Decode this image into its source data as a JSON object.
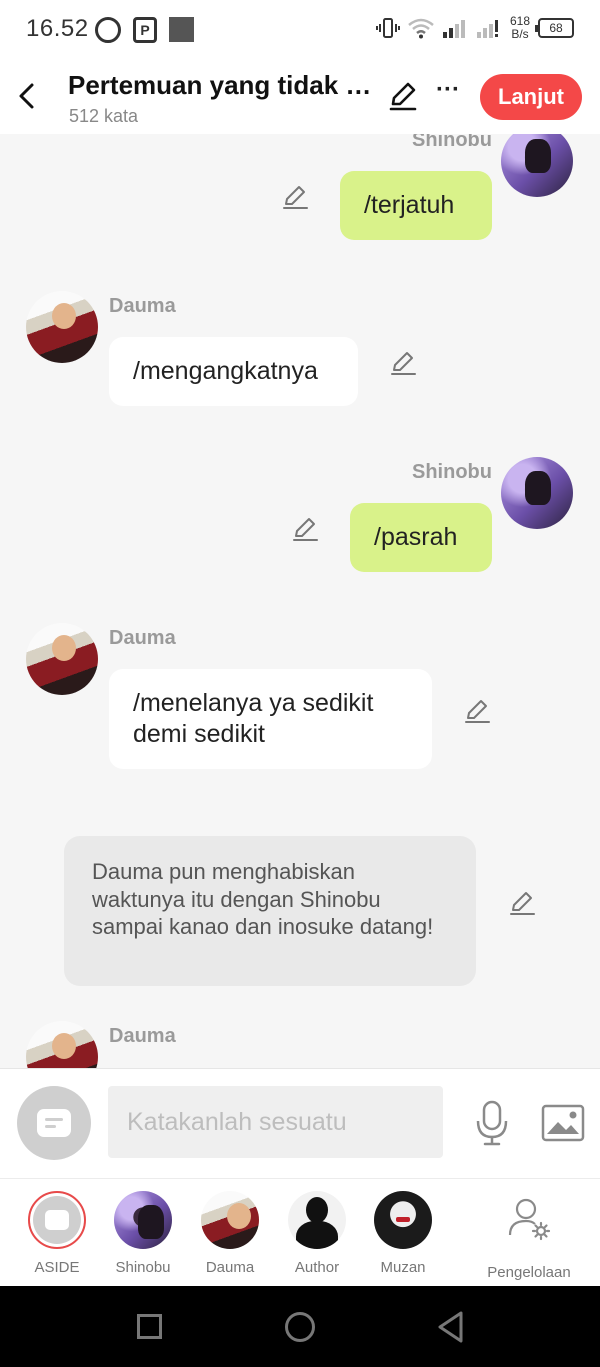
{
  "status_bar": {
    "time": "16.52",
    "net_speed_value": "618",
    "net_speed_unit": "B/s",
    "battery": "68"
  },
  "header": {
    "title": "Pertemuan yang tidak b...",
    "word_count": "512 kata",
    "continue_label": "Lanjut",
    "more_label": "···"
  },
  "messages": [
    {
      "speaker": "Shinobu",
      "text": "/terjatuh",
      "side": "right"
    },
    {
      "speaker": "Dauma",
      "text": "/mengangkatnya",
      "side": "left"
    },
    {
      "speaker": "Shinobu",
      "text": "/pasrah",
      "side": "right"
    },
    {
      "speaker": "Dauma",
      "text": "/menelanya ya sedikit demi sedikit",
      "side": "left"
    },
    {
      "speaker": "",
      "text": "Dauma pun menghabiskan waktunya itu dengan Shinobu sampai kanao dan inosuke datang!",
      "side": "narration"
    },
    {
      "speaker": "Dauma",
      "text": "",
      "side": "left"
    }
  ],
  "input": {
    "placeholder": "Katakanlah sesuatu"
  },
  "characters": [
    {
      "label": "ASIDE"
    },
    {
      "label": "Shinobu"
    },
    {
      "label": "Dauma"
    },
    {
      "label": "Author"
    },
    {
      "label": "Muzan"
    },
    {
      "label": "Pengelolaan"
    }
  ],
  "colors": {
    "accent": "#f44848",
    "right_bubble": "#d9f28a",
    "left_bubble": "#ffffff",
    "narration_bg": "#e9e9e9",
    "background": "#f6f6f6"
  }
}
